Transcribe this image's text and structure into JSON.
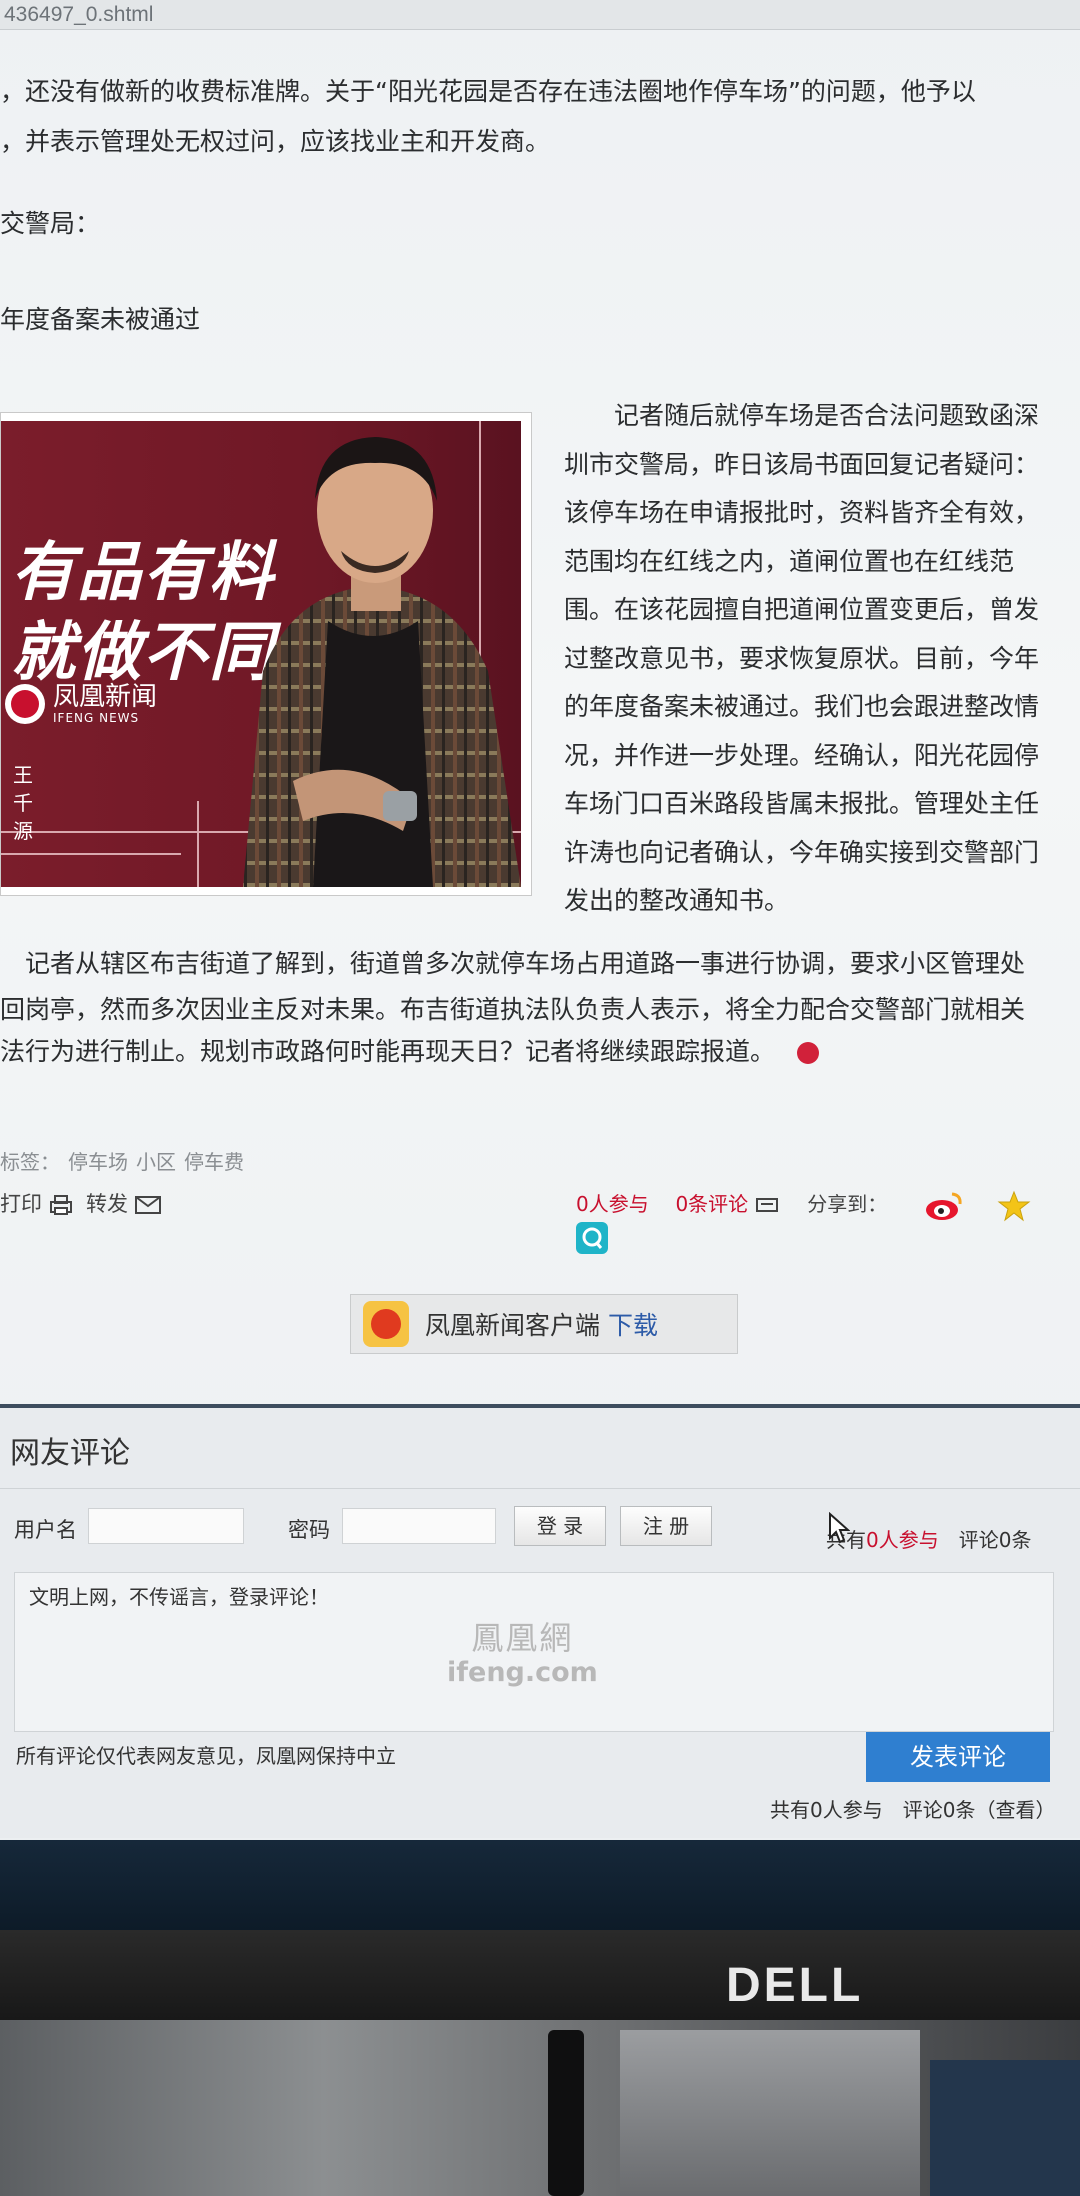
{
  "browser": {
    "url_fragment": "436497_0.shtml"
  },
  "article": {
    "p1_line1": "，还没有做新的收费标准牌。关于“阳光花园是否存在违法圈地作停车场”的问题，他予以",
    "p1_line2": "，并表示管理处无权过问，应该找业主和开发商。",
    "p2": "交警局：",
    "p3": "年度备案未被通过",
    "col_right_lines": [
      "　　记者随后就停车场是否合法问题致函深",
      "圳市交警局，昨日该局书面回复记者疑问：",
      "该停车场在申请报批时，资料皆齐全有效，",
      "范围均在红线之内，道闸位置也在红线范",
      "围。在该花园擅自把道闸位置变更后，曾发",
      "过整改意见书，要求恢复原状。目前，今年",
      "的年度备案未被通过。我们也会跟进整改情",
      "况，并作进一步处理。经确认，阳光花园停",
      "车场门口百米路段皆属未报批。管理处主任",
      "许涛也向记者确认，今年确实接到交警部门",
      "发出的整改通知书。"
    ],
    "p4_line1": "　记者从辖区布吉街道了解到，街道曾多次就停车场占用道路一事进行协调，要求小区管理处",
    "p4_line2": "回岗亭，然而多次因业主反对未果。布吉街道执法队负责人表示，将全力配合交警部门就相关",
    "p4_line3": "法行为进行制止。规划市政路何时能再现天日？记者将继续跟踪报道。"
  },
  "ad": {
    "slogan_1": "有品有料",
    "slogan_2": "就做不同",
    "logo_cn": "凤凰新闻",
    "logo_en": "IFENG NEWS",
    "name": "王千源"
  },
  "tags": {
    "label": "标签：",
    "items": [
      "停车场",
      "小区",
      "停车费"
    ]
  },
  "tools": {
    "print": "打印",
    "forward": "转发",
    "participants": "0人参与",
    "comments": "0条评论",
    "share_label": "分享到："
  },
  "app_download": {
    "name": "凤凰新闻客户端",
    "action": "下载"
  },
  "comments": {
    "title": "网友评论",
    "username_label": "用户名",
    "password_label": "密码",
    "login_btn": "登 录",
    "register_btn": "注 册",
    "stats_top_prefix": "共有",
    "stats_top_people": "0人参与",
    "stats_top_comments": "评论0条",
    "placeholder": "文明上网，不传谣言，登录评论！",
    "watermark_cn": "鳳凰網",
    "watermark_en": "ifeng.com",
    "disclaimer": "所有评论仅代表网友意见，凤凰网保持中立",
    "submit": "发表评论",
    "stats_bottom": "共有0人参与　评论0条（查看）"
  },
  "monitor": {
    "brand": "DELL"
  }
}
